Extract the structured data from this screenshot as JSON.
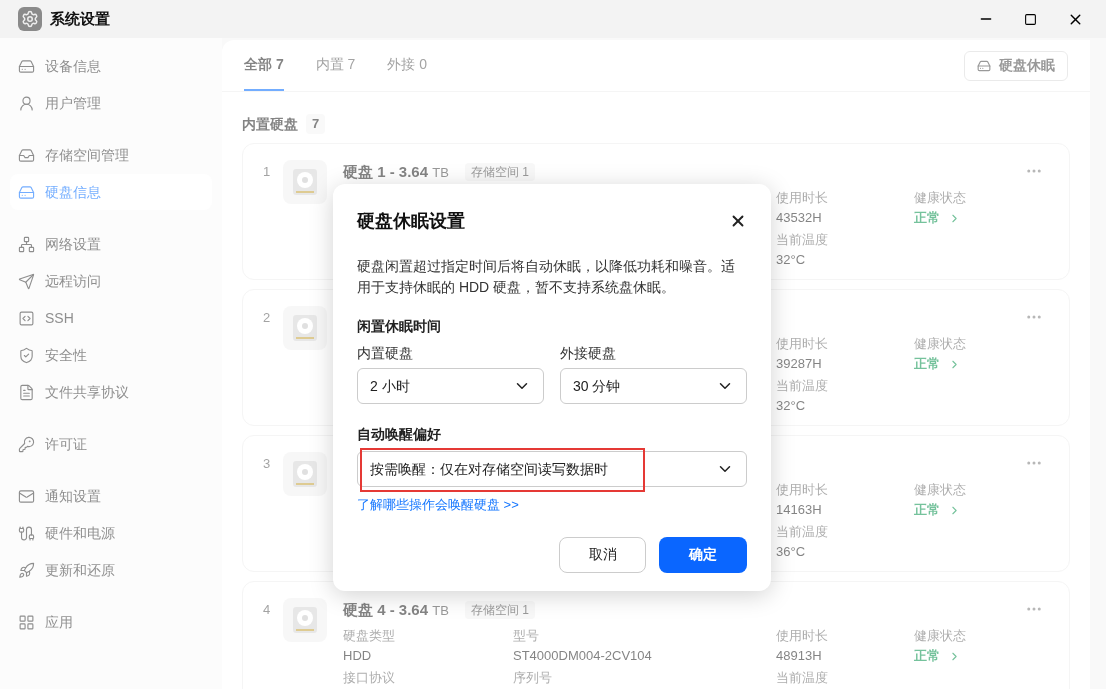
{
  "window": {
    "title": "系统设置"
  },
  "sidebar": {
    "groups": [
      {
        "items": [
          {
            "label": "设备信息",
            "selected": false
          },
          {
            "label": "用户管理",
            "selected": false
          }
        ]
      },
      {
        "items": [
          {
            "label": "存储空间管理",
            "selected": false
          },
          {
            "label": "硬盘信息",
            "selected": true
          }
        ]
      },
      {
        "items": [
          {
            "label": "网络设置",
            "selected": false
          },
          {
            "label": "远程访问",
            "selected": false
          },
          {
            "label": "SSH",
            "selected": false
          },
          {
            "label": "安全性",
            "selected": false
          },
          {
            "label": "文件共享协议",
            "selected": false
          }
        ]
      },
      {
        "items": [
          {
            "label": "许可证",
            "selected": false
          }
        ]
      },
      {
        "items": [
          {
            "label": "通知设置",
            "selected": false
          },
          {
            "label": "硬件和电源",
            "selected": false
          },
          {
            "label": "更新和还原",
            "selected": false
          }
        ]
      },
      {
        "items": [
          {
            "label": "应用",
            "selected": false
          }
        ]
      }
    ]
  },
  "tabs": [
    {
      "label": "全部 7",
      "selected": true
    },
    {
      "label": "内置 7",
      "selected": false
    },
    {
      "label": "外接 0",
      "selected": false
    }
  ],
  "sleep_button": "硬盘休眠",
  "section": {
    "title": "内置硬盘",
    "count": "7"
  },
  "disks": [
    {
      "number": "1",
      "title": "硬盘 1 - 3.64",
      "unit": "TB",
      "badge": "存储空间 1",
      "usage_time": {
        "label": "使用时长",
        "value": "43532H"
      },
      "health": {
        "label": "健康状态",
        "value": "正常"
      },
      "temperature": {
        "label": "当前温度",
        "value": "32°C"
      }
    },
    {
      "number": "2",
      "usage_time": {
        "label": "使用时长",
        "value": "39287H"
      },
      "health": {
        "label": "健康状态",
        "value": "正常"
      },
      "temperature": {
        "label": "当前温度",
        "value": "32°C"
      }
    },
    {
      "number": "3",
      "usage_time": {
        "label": "使用时长",
        "value": "14163H"
      },
      "health": {
        "label": "健康状态",
        "value": "正常"
      },
      "temperature": {
        "label": "当前温度",
        "value": "36°C"
      }
    },
    {
      "number": "4",
      "title": "硬盘 4 - 3.64",
      "unit": "TB",
      "badge": "存储空间 1",
      "disk_type": {
        "label": "硬盘类型",
        "value": "HDD"
      },
      "model": {
        "label": "型号",
        "value": "ST4000DM004-2CV104"
      },
      "usage_time": {
        "label": "使用时长",
        "value": "48913H"
      },
      "health": {
        "label": "健康状态",
        "value": "正常"
      },
      "interface": {
        "label": "接口协议"
      },
      "serial": {
        "label": "序列号"
      },
      "temperature": {
        "label": "当前温度"
      }
    }
  ],
  "dialog": {
    "title": "硬盘休眠设置",
    "description": "硬盘闲置超过指定时间后将自动休眠，以降低功耗和噪音。适用于支持休眠的 HDD 硬盘，暂不支持系统盘休眠。",
    "idle_title": "闲置休眠时间",
    "selects": [
      {
        "label": "内置硬盘",
        "value": "2 小时"
      },
      {
        "label": "外接硬盘",
        "value": "30 分钟"
      }
    ],
    "wake_title": "自动唤醒偏好",
    "wake_select": {
      "value": "按需唤醒：仅在对存储空间读写数据时",
      "highlighted": true
    },
    "link": "了解哪些操作会唤醒硬盘 >>",
    "cancel": "取消",
    "confirm": "确定"
  }
}
